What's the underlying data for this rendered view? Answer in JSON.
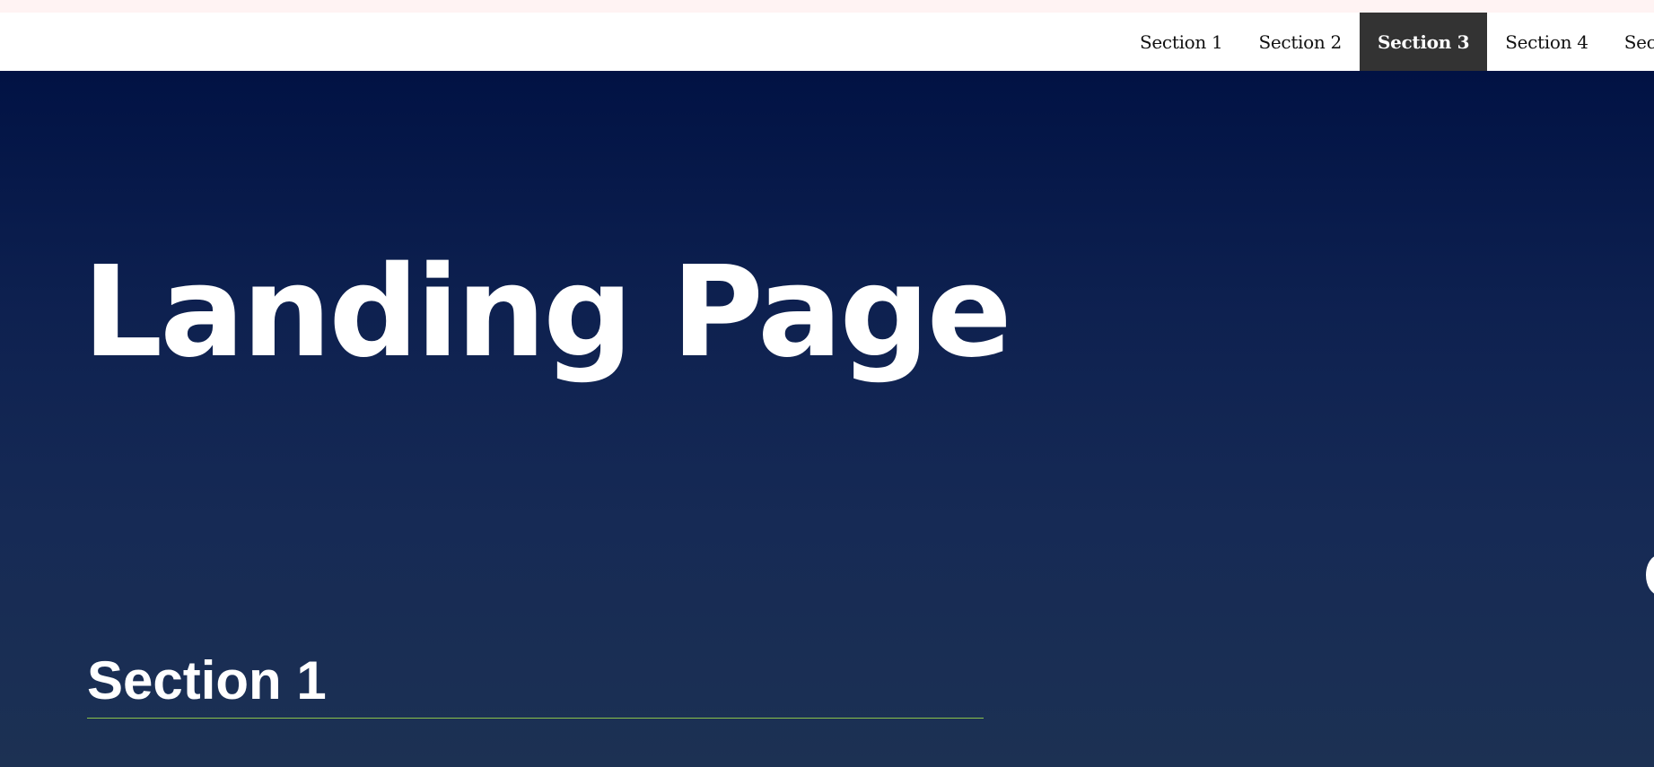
{
  "nav": {
    "items": [
      {
        "label": "Section 1",
        "active": false
      },
      {
        "label": "Section 2",
        "active": false
      },
      {
        "label": "Section 3",
        "active": true
      },
      {
        "label": "Section 4",
        "active": false
      },
      {
        "label": "Sectio",
        "active": false
      }
    ]
  },
  "hero": {
    "title": "Landing Page"
  },
  "section1": {
    "heading": "Section 1"
  },
  "colors": {
    "nav_background": "#ffffff",
    "nav_active_background": "#333333",
    "hero_gradient_top": "#011244",
    "hero_gradient_bottom": "#1c3153",
    "heading_rule": "#8bc34a"
  }
}
